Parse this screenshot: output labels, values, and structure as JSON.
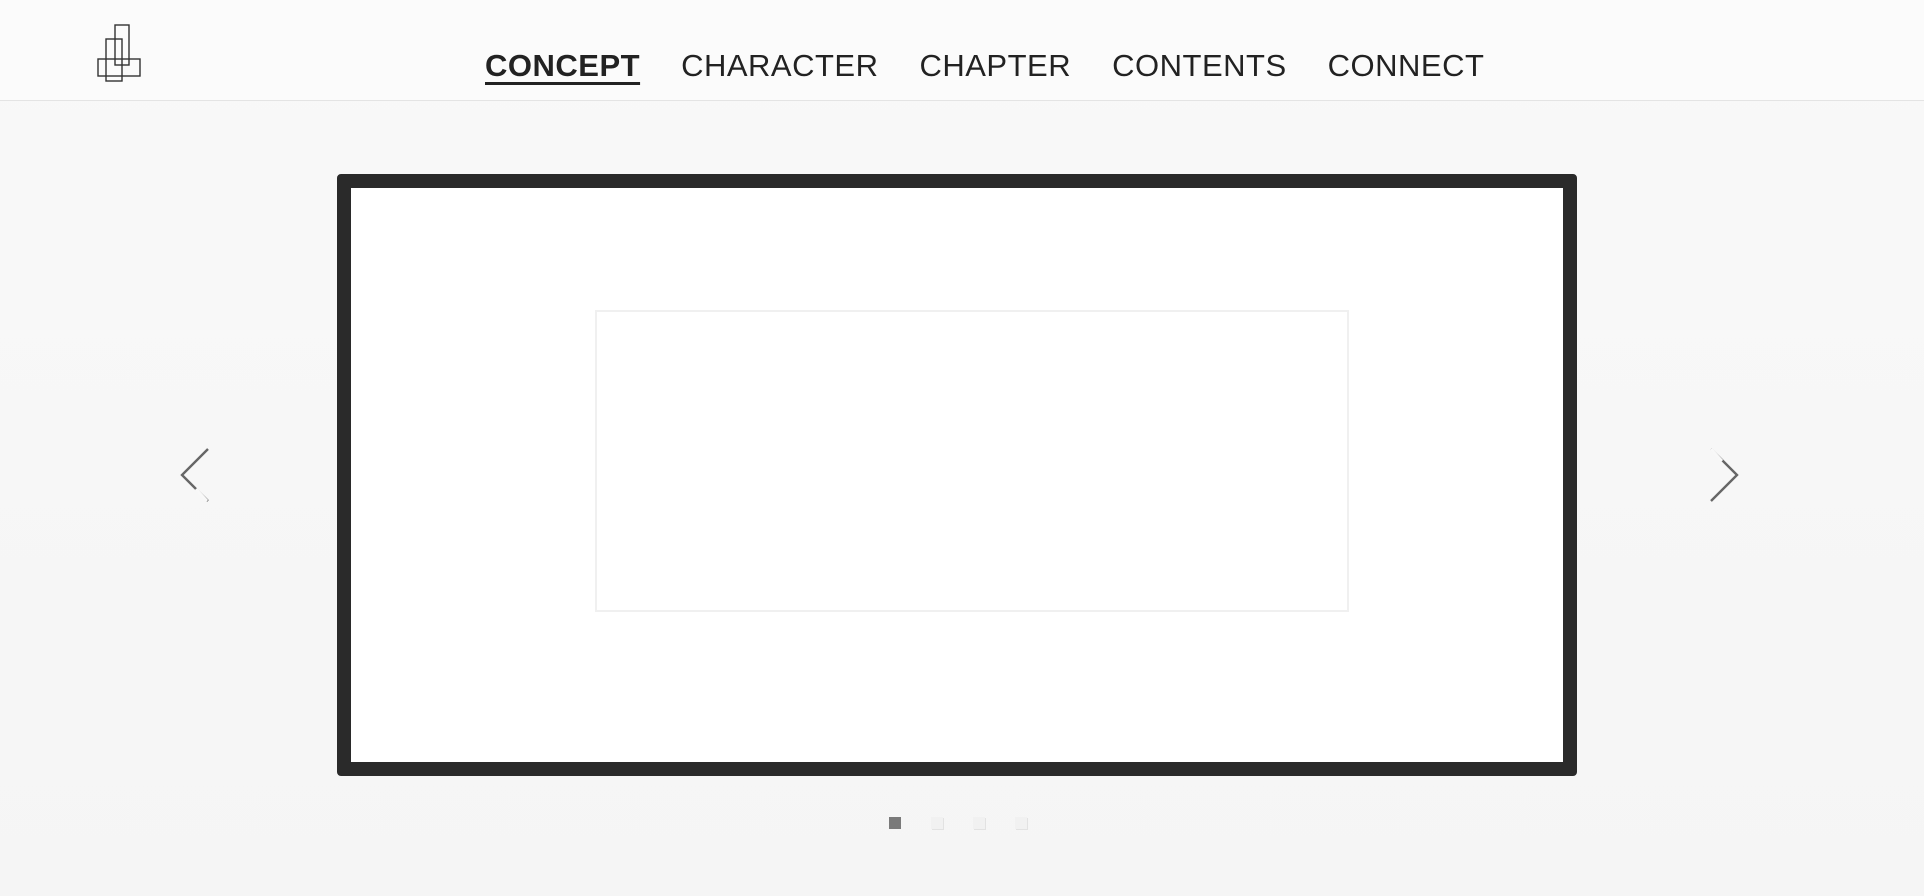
{
  "header": {
    "logo_icon": "stacked-rectangles-logo-icon",
    "nav": [
      {
        "label": "CONCEPT",
        "active": true
      },
      {
        "label": "CHARACTER",
        "active": false
      },
      {
        "label": "CHAPTER",
        "active": false
      },
      {
        "label": "CONTENTS",
        "active": false
      },
      {
        "label": "CONNECT",
        "active": false
      }
    ]
  },
  "slider": {
    "prev_icon": "chevron-left-icon",
    "next_icon": "chevron-right-icon",
    "frame_color": "#2a2a2a",
    "dots_total": 4,
    "active_dot": 1
  }
}
